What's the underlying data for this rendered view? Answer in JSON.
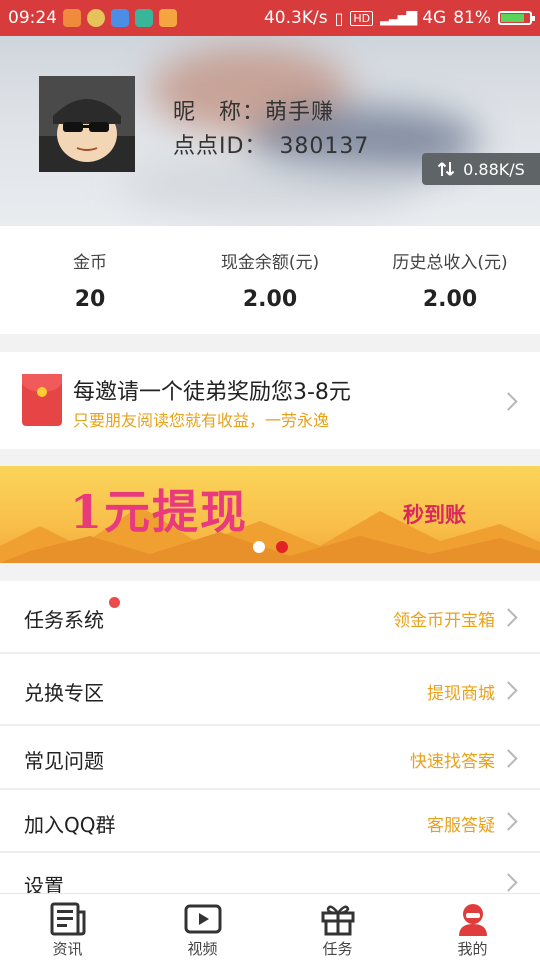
{
  "status_bar": {
    "time": "09:24",
    "net_speed": "40.3K/s",
    "hd": "HD",
    "network": "4G",
    "battery": "81%",
    "battery_level": 0.81
  },
  "profile": {
    "nickname_label": "昵　称：",
    "nickname": "萌手赚",
    "id_label": "点点ID：",
    "id": "380137",
    "speed": "0.88K/S"
  },
  "stats": [
    {
      "label": "金币",
      "value": "20"
    },
    {
      "label": "现金余额(元)",
      "value": "2.00"
    },
    {
      "label": "历史总收入(元)",
      "value": "2.00"
    }
  ],
  "invite": {
    "title": "每邀请一个徒弟奖励您3-8元",
    "subtitle": "只要朋友阅读您就有收益，一劳永逸"
  },
  "banner": {
    "title": "1元提现",
    "subtitle": "秒到账",
    "active_index": 1
  },
  "menu": [
    {
      "label": "任务系统",
      "hint": "领金币开宝箱"
    },
    {
      "label": "兑换专区",
      "hint": "提现商城"
    },
    {
      "label": "常见问题",
      "hint": "快速找答案"
    },
    {
      "label": "加入QQ群",
      "hint": "客服答疑"
    },
    {
      "label": "设置",
      "hint": ""
    }
  ],
  "tabs": [
    {
      "label": "资讯",
      "icon": "news-icon"
    },
    {
      "label": "视频",
      "icon": "video-icon"
    },
    {
      "label": "任务",
      "icon": "gift-icon"
    },
    {
      "label": "我的",
      "icon": "user-icon"
    }
  ],
  "colors": {
    "status_bar": "#d83b3b",
    "accent_orange": "#e8a21c",
    "tab_active": "#e03c3c"
  }
}
